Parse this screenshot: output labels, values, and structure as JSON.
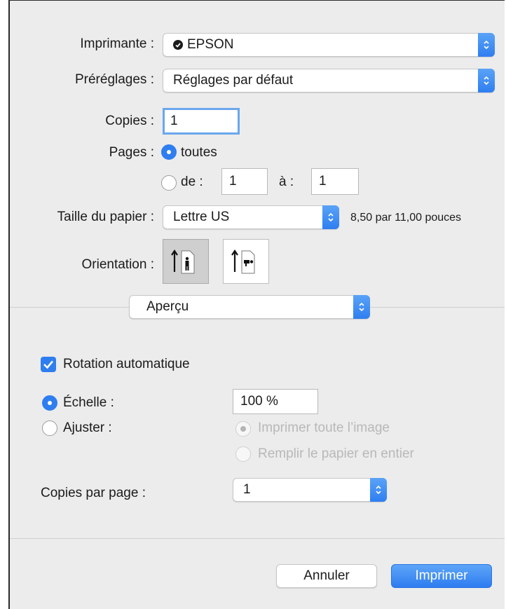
{
  "printer": {
    "label": "Imprimante :",
    "value": "EPSON"
  },
  "presets": {
    "label": "Préréglages :",
    "value": "Réglages par défaut"
  },
  "copies": {
    "label": "Copies :",
    "value": "1"
  },
  "pages": {
    "label": "Pages :",
    "all_label": "toutes",
    "range_label": "de :",
    "from_value": "1",
    "to_label": "à :",
    "to_value": "1"
  },
  "paper_size": {
    "label": "Taille du papier :",
    "value": "Lettre US",
    "dimensions": "8,50 par 11,00 pouces"
  },
  "orientation": {
    "label": "Orientation :",
    "options": [
      "portrait",
      "landscape"
    ],
    "selected": "portrait"
  },
  "section_popup": {
    "value": "Aperçu"
  },
  "auto_rotate": {
    "label": "Rotation automatique",
    "checked": true
  },
  "scale": {
    "label": "Échelle :",
    "value": "100 %",
    "selected": true
  },
  "fit": {
    "label": "Ajuster :",
    "option_print_all": "Imprimer toute l’image",
    "option_fill": "Remplir le papier en entier"
  },
  "copies_per_page": {
    "label": "Copies par page :",
    "value": "1"
  },
  "buttons": {
    "cancel": "Annuler",
    "print": "Imprimer"
  },
  "colors": {
    "accent": "#2f7ef0",
    "panel": "#ececec"
  }
}
